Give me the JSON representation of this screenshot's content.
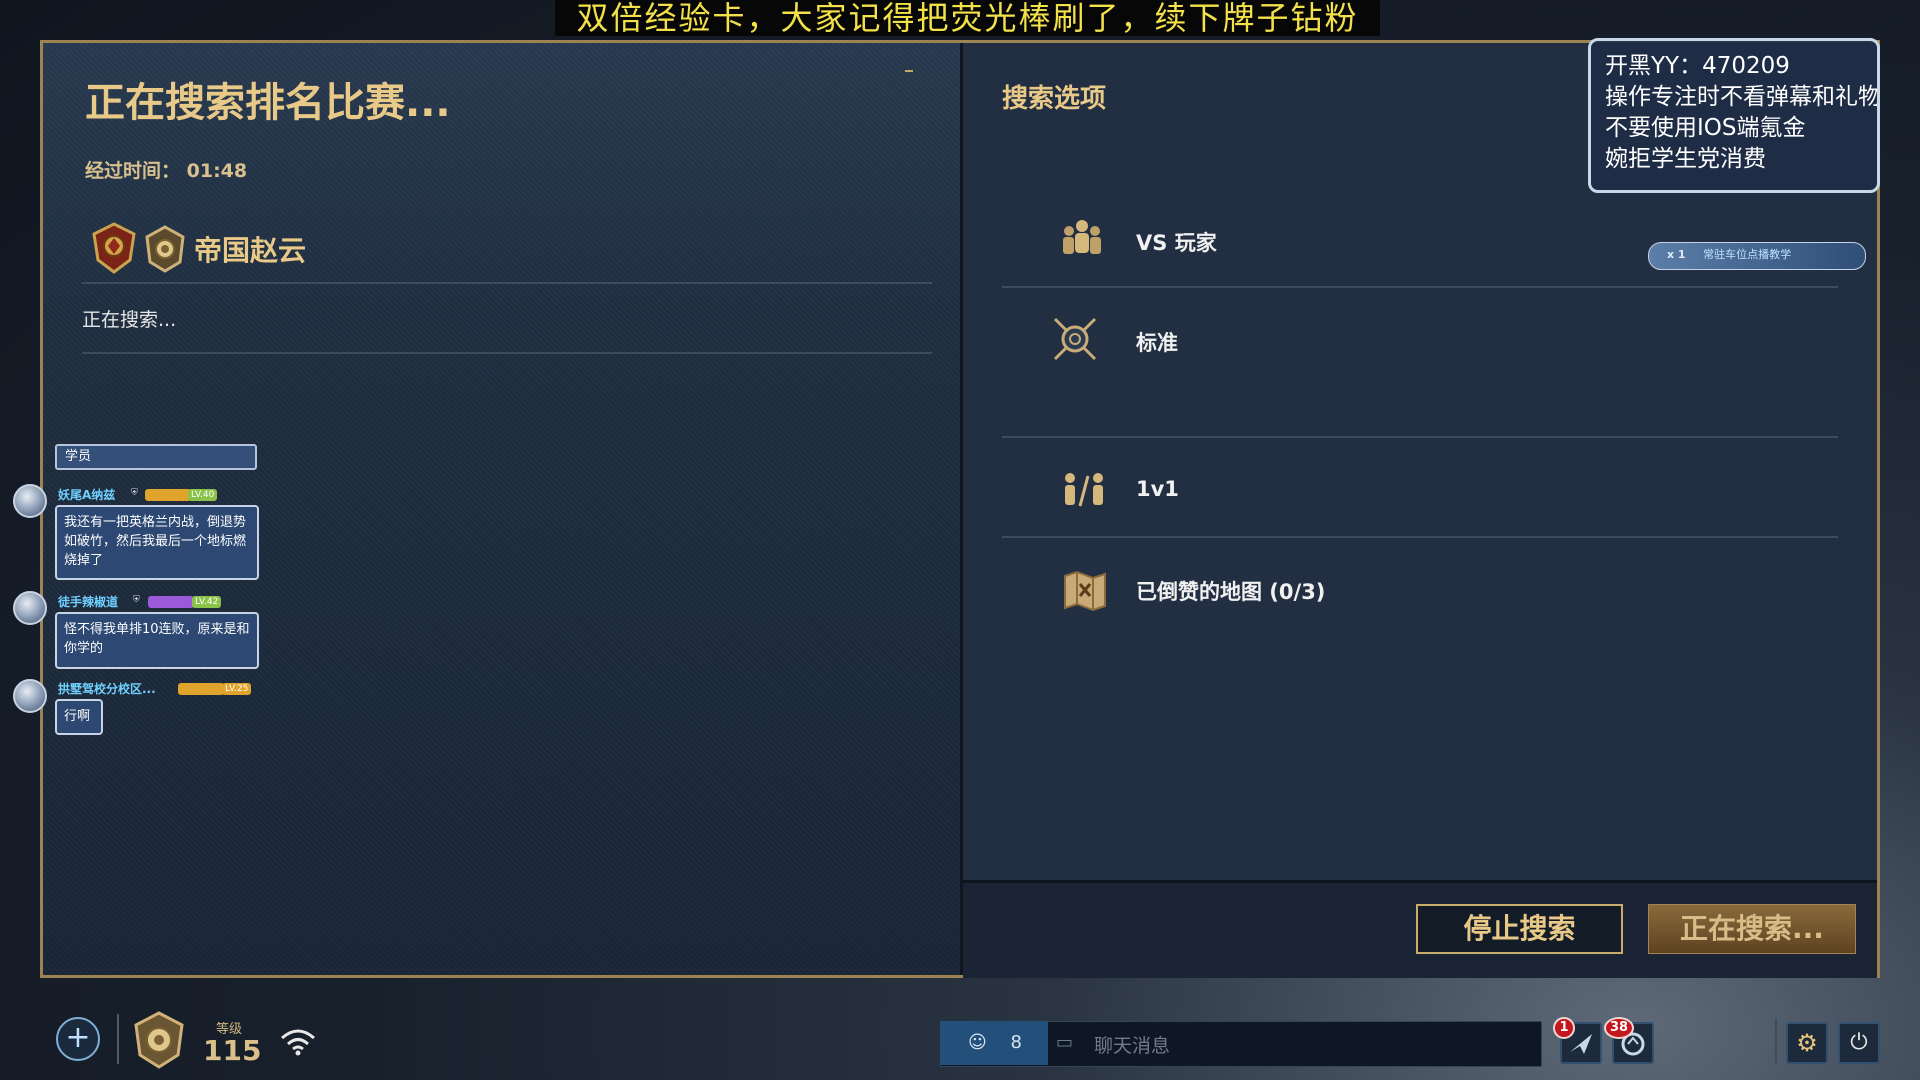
{
  "banner": {
    "text": "双倍经验卡，大家记得把荧光棒刷了，续下牌子钻粉"
  },
  "search": {
    "title": "正在搜索排名比赛...",
    "elapsed_label": "经过时间：",
    "elapsed_value": "01:48",
    "player_name": "帝国赵云",
    "status": "正在搜索..."
  },
  "chat": {
    "header": "学员",
    "messages": [
      {
        "user": "妖尾A纳兹",
        "level": "LV.40",
        "text": "我还有一把英格兰内战，倒退势如破竹，然后我最后一个地标燃烧掉了"
      },
      {
        "user": "徒手辣椒道",
        "level": "LV.42",
        "text": "怪不得我单排10连败，原来是和你学的"
      },
      {
        "user": "拱墅驾校分校区...",
        "level": "LV.25",
        "text": "行啊"
      }
    ]
  },
  "options": {
    "title": "搜索选项",
    "items": [
      {
        "label": "VS 玩家",
        "icon": "players-icon"
      },
      {
        "label": "标准",
        "icon": "crossed-swords-icon"
      },
      {
        "label": "1v1",
        "icon": "one-vs-one-icon"
      },
      {
        "label": "已倒赞的地图 (0/3)",
        "icon": "map-icon"
      }
    ]
  },
  "yy_box": {
    "lines": [
      "开黑YY：470209",
      "操作专注时不看弹幕和礼物",
      "不要使用IOS端氪金",
      "婉拒学生党消费"
    ]
  },
  "badge": {
    "count": "x 1",
    "text": "常驻车位点播教学"
  },
  "buttons": {
    "stop": "停止搜索",
    "searching": "正在搜索..."
  },
  "hud": {
    "level_label": "等级",
    "level": "115",
    "friends_online": "8",
    "chat_placeholder": "聊天消息",
    "notif_1": "1",
    "notif_2": "38"
  },
  "colors": {
    "gold": "#e8c987",
    "frame": "#9b8452",
    "panel": "#222f43",
    "banner_text": "#f3e14a"
  }
}
